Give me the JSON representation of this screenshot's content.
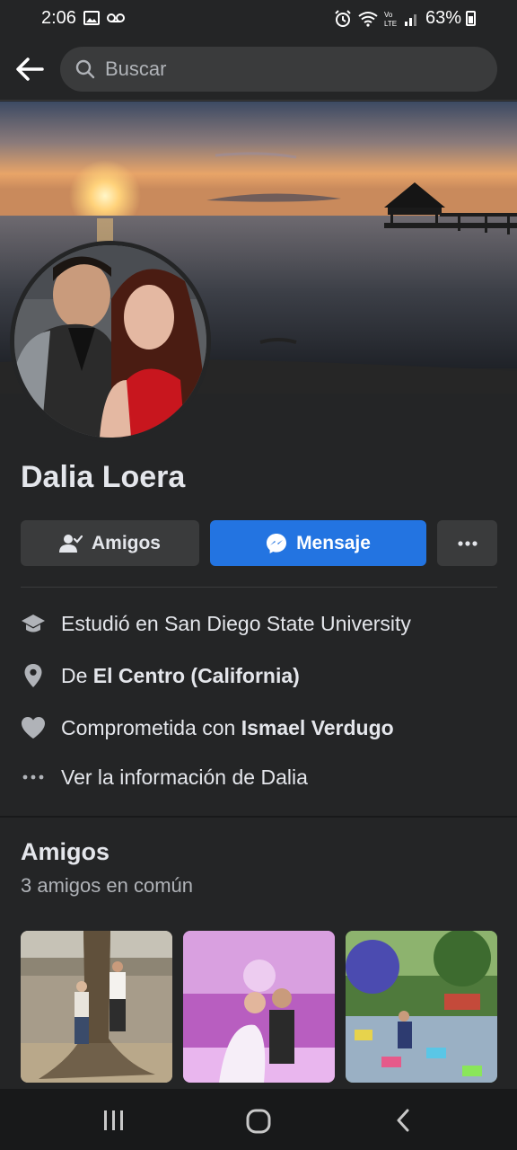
{
  "status_bar": {
    "time": "2:06",
    "battery": "63%",
    "icons": [
      "gallery-icon",
      "voicemail-icon",
      "alarm-icon",
      "wifi-icon",
      "volte-icon",
      "signal-icon",
      "battery-icon"
    ]
  },
  "search": {
    "placeholder": "Buscar"
  },
  "profile": {
    "name": "Dalia Loera"
  },
  "actions": {
    "friends_label": "Amigos",
    "message_label": "Mensaje"
  },
  "info": {
    "studied": "Estudió en San Diego State University",
    "from_prefix": "De ",
    "from_place": "El Centro (California)",
    "relationship_prefix": "Comprometida con ",
    "relationship_partner": "Ismael Verdugo",
    "see_info": "Ver la información de Dalia"
  },
  "friends": {
    "title": "Amigos",
    "subtitle": "3 amigos en común"
  },
  "colors": {
    "background": "#242526",
    "accent": "#2374e1",
    "button_gray": "#3a3b3c",
    "text": "#e4e6eb",
    "subtext": "#b0b3b8"
  }
}
